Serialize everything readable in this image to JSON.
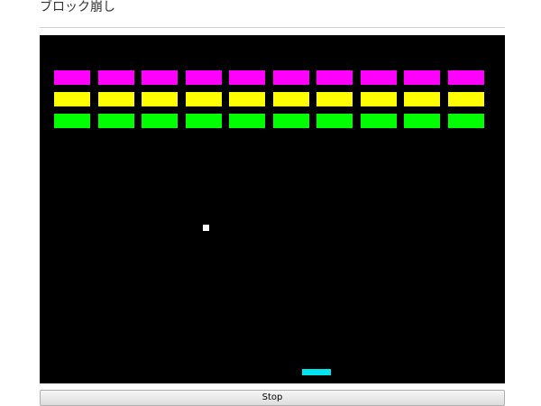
{
  "header": {
    "title": "ブロック崩し"
  },
  "game": {
    "background_color": "#000000",
    "brick_rows": [
      {
        "color": "#ff00ff",
        "bricks": 10
      },
      {
        "color": "#ffff00",
        "bricks": 10
      },
      {
        "color": "#00ff00",
        "bricks": 10
      }
    ],
    "ball_color": "#ffffff",
    "paddle_color": "#00e5ee"
  },
  "controls": {
    "stop_label": "Stop"
  }
}
